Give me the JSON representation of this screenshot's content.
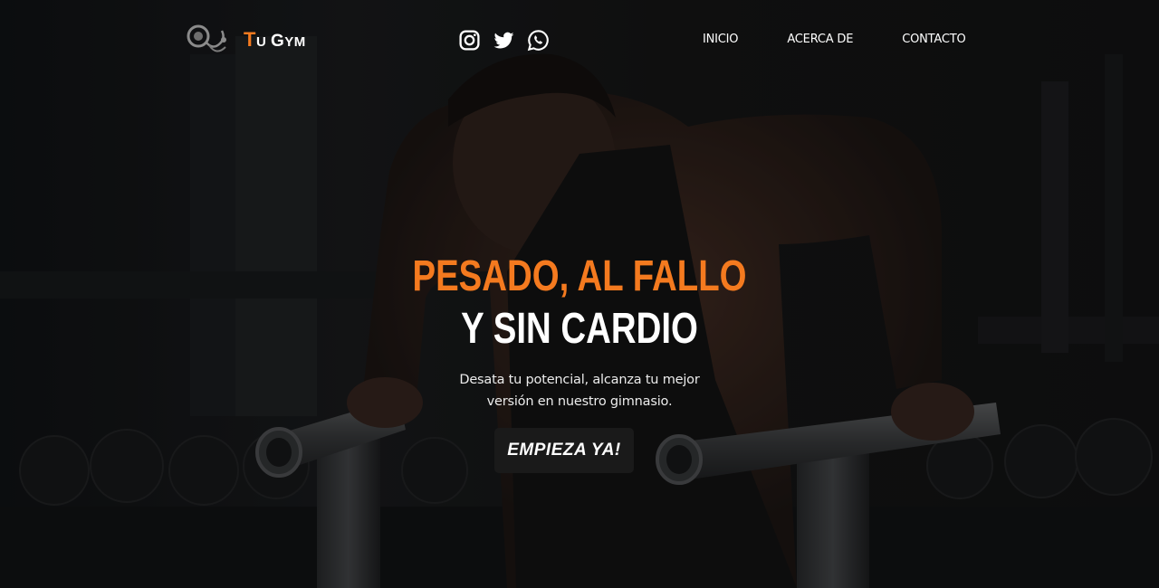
{
  "brand": {
    "name_first": "T",
    "name_rest_a": "U ",
    "name_second": "G",
    "name_rest_b": "YM",
    "logo_icon": "gym-logo-icon"
  },
  "social": [
    {
      "icon": "instagram-icon"
    },
    {
      "icon": "twitter-icon"
    },
    {
      "icon": "whatsapp-icon"
    }
  ],
  "nav": {
    "items": [
      {
        "label": "INICIO"
      },
      {
        "label": "ACERCA DE"
      },
      {
        "label": "CONTACTO"
      }
    ]
  },
  "hero": {
    "headline_line1": "PESADO, AL FALLO",
    "headline_line2": "Y SIN CARDIO",
    "subtitle_line1": "Desata tu potencial, alcanza tu mejor",
    "subtitle_line2": "versión en nuestro gimnasio.",
    "cta_label": "EMPIEZA YA!"
  },
  "colors": {
    "accent": "#f47a1f",
    "text": "#ffffff",
    "overlay": "#0d0d0d",
    "button_bg": "#1a1a1a"
  }
}
